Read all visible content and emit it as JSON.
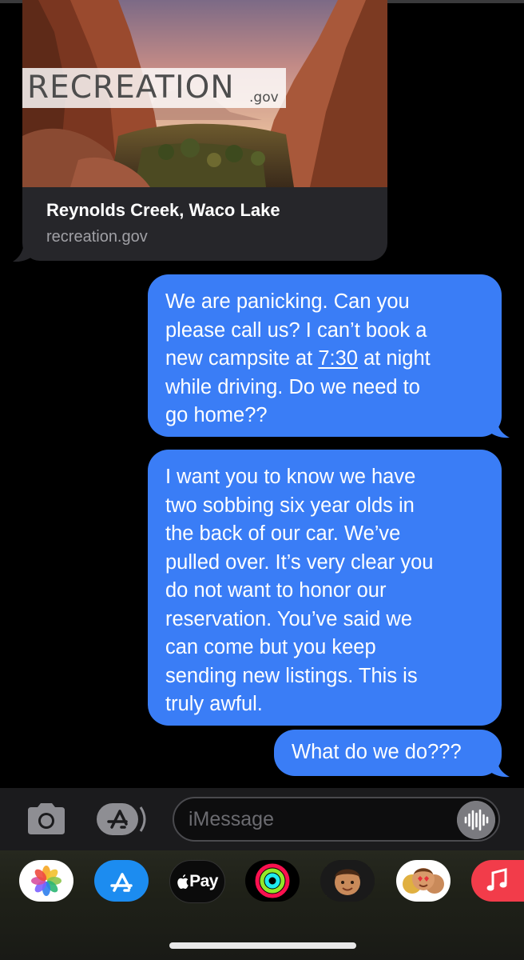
{
  "link_preview": {
    "brand_text": "RECREATION",
    "brand_domain": ".gov",
    "title": "Reynolds Creek, Waco Lake",
    "url": "recreation.gov"
  },
  "messages": [
    {
      "direction": "outgoing",
      "lines": [
        "We are panicking. Can you",
        "please call us? I can’t book a",
        "new campsite at ",
        "7:30",
        " at night",
        "while driving. Do we need to",
        "go home??"
      ]
    },
    {
      "direction": "outgoing",
      "lines": [
        "I want you to know we have",
        "two sobbing six year olds in",
        "the back of our car. We’ve",
        "pulled over. It’s very clear you",
        "do not want to honor our",
        "reservation. You’ve said we",
        "can come but you keep",
        "sending new listings. This is",
        "truly awful."
      ]
    },
    {
      "direction": "outgoing",
      "lines": [
        "What do we do???"
      ]
    }
  ],
  "compose": {
    "placeholder": "iMessage",
    "camera_icon": "camera-icon",
    "apps_icon": "app-store-icon",
    "audio_icon": "waveform-icon"
  },
  "app_strip": {
    "icons": [
      "photos-icon",
      "app-store-icon",
      "apple-pay-icon",
      "activity-icon",
      "memoji-icon",
      "memoji-stickers-icon",
      "music-icon"
    ],
    "apple_pay_label": "Pay"
  },
  "colors": {
    "bubble_blue": "#3a7df6",
    "background": "#000000",
    "card_background": "#26262a"
  }
}
